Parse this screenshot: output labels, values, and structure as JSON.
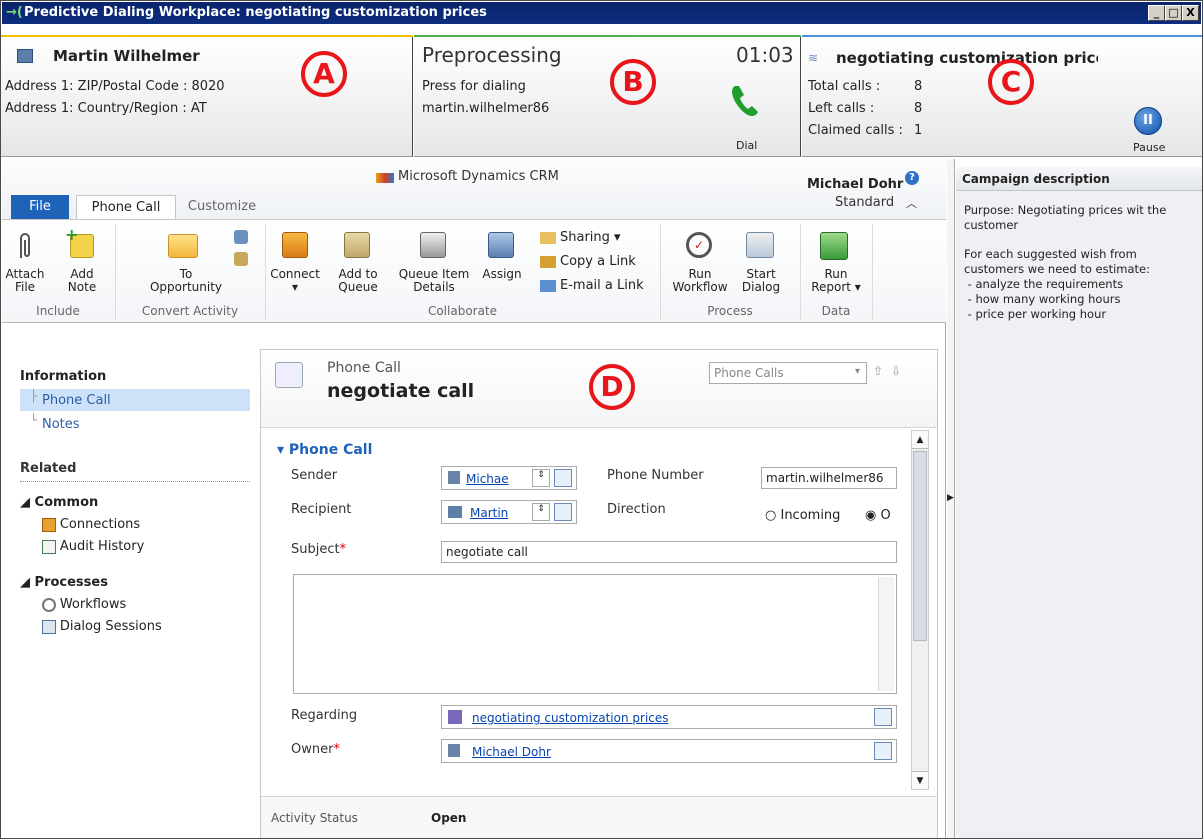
{
  "window": {
    "title": "Predictive Dialing Workplace: negotiating customization prices",
    "controls": [
      "_",
      "□",
      "X"
    ]
  },
  "callee": {
    "name": "Martin Wilhelmer",
    "lines": [
      "Address 1: ZIP/Postal Code : 8020",
      "Address 1: Country/Region : AT"
    ],
    "marker": "A"
  },
  "dialer": {
    "state": "Preprocessing",
    "timer": "01:03",
    "hint": "Press for dialing",
    "user": "martin.wilhelmer86",
    "dial_label": "Dial",
    "marker": "B"
  },
  "campaign": {
    "title": "negotiating customization prices",
    "stats": [
      {
        "label": "Total calls :",
        "value": "8"
      },
      {
        "label": "Left calls :",
        "value": "8"
      },
      {
        "label": "Claimed calls :",
        "value": "1"
      }
    ],
    "pause_label": "Pause",
    "marker": "C",
    "description_header": "Campaign description",
    "description": [
      "Purpose: Negotiating prices wit the",
      "customer",
      "",
      "For each suggested wish from",
      "customers we need to estimate:",
      " - analyze the requirements",
      " - how many working hours",
      " - price per working hour"
    ]
  },
  "crm": {
    "brand": "Microsoft Dynamics CRM",
    "user": "Michael Dohr",
    "role": "Standard",
    "tabs": [
      "File",
      "Phone Call",
      "Customize"
    ],
    "groups": {
      "include": {
        "label": "Include",
        "buttons": [
          "Attach\nFile",
          "Add\nNote"
        ]
      },
      "convert": {
        "label": "Convert Activity",
        "buttons": [
          "To\nOpportunity"
        ]
      },
      "collaborate": {
        "label": "Collaborate",
        "buttons": [
          "Connect",
          "Add to\nQueue",
          "Queue Item\nDetails",
          "Assign"
        ],
        "small": [
          "Sharing",
          "Copy a Link",
          "E-mail a Link"
        ]
      },
      "process": {
        "label": "Process",
        "buttons": [
          "Run\nWorkflow",
          "Start\nDialog"
        ]
      },
      "data": {
        "label": "Data",
        "buttons": [
          "Run\nReport"
        ]
      }
    },
    "nav": {
      "information_header": "Information",
      "information_items": [
        "Phone Call",
        "Notes"
      ],
      "related_header": "Related",
      "common_header": "Common",
      "common_items": [
        "Connections",
        "Audit History"
      ],
      "processes_header": "Processes",
      "process_items": [
        "Workflows",
        "Dialog Sessions"
      ]
    },
    "record": {
      "entity": "Phone Call",
      "title": "negotiate call",
      "view_select": "Phone Calls",
      "marker": "D",
      "section": "Phone Call",
      "labels": {
        "sender": "Sender",
        "recipient": "Recipient",
        "phone": "Phone Number",
        "direction": "Direction",
        "subject": "Subject",
        "regarding": "Regarding",
        "owner": "Owner"
      },
      "sender": "Michae",
      "recipient": "Martin",
      "phone": "martin.wilhelmer86",
      "direction_options": [
        "Incoming",
        "O"
      ],
      "subject": "negotiate call",
      "regarding": "negotiating customization prices",
      "owner": "Michael Dohr",
      "required_mark": "*",
      "status_label": "Activity Status",
      "status": "Open"
    }
  },
  "colors": {
    "accent_b": "#4caf50",
    "accent_a": "#f0c000",
    "marker": "#e8161b",
    "link": "#0645ad",
    "file_tab": "#1f63b8"
  }
}
